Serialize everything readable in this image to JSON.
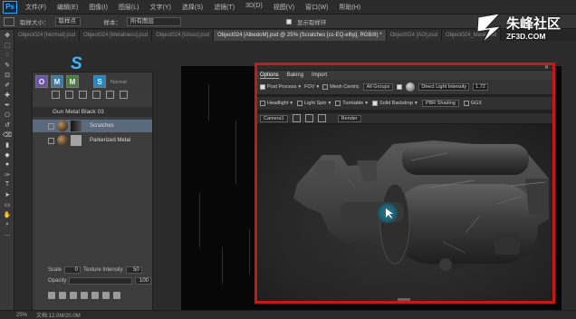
{
  "app": {
    "logo": "Ps"
  },
  "menubar": {
    "items": [
      "文件(F)",
      "编辑(E)",
      "图像(I)",
      "图层(L)",
      "文字(Y)",
      "选择(S)",
      "滤镜(T)",
      "3D(D)",
      "视图(V)",
      "窗口(W)",
      "帮助(H)"
    ]
  },
  "options_bar": {
    "sample_size_label": "取样大小：",
    "sample_size_value": "取样点",
    "sample_label": "样本：",
    "sample_value": "所有图层",
    "show_ring_label": "显示取样环"
  },
  "doc_tabs": [
    {
      "label": "Object024 [Normal].psd",
      "active": false
    },
    {
      "label": "Object024 [Metalness].psd",
      "active": false
    },
    {
      "label": "Object024 [Gloss].psd",
      "active": false
    },
    {
      "label": "Object024 [AlbedoM].psd @ 25% (Scratches [cc-EQ-elhp], RGB/8) *",
      "active": true
    },
    {
      "label": "Object024 [AO].psd",
      "active": false
    },
    {
      "label": "Object024_Mask.psd",
      "active": false
    }
  ],
  "toolbar": {
    "tools": [
      "move-tool",
      "marquee-tool",
      "lasso-tool",
      "quick-select-tool",
      "crop-tool",
      "eyedropper-tool",
      "healing-tool",
      "brush-tool",
      "clone-tool",
      "history-brush-tool",
      "eraser-tool",
      "gradient-tool",
      "blur-tool",
      "dodge-tool",
      "pen-tool",
      "type-tool",
      "path-select-tool",
      "shape-tool",
      "hand-tool",
      "zoom-tool",
      "more-tools"
    ],
    "glyphs": [
      "✥",
      "⬚",
      "◌",
      "✎",
      "⊡",
      "✐",
      "✚",
      "✒",
      "⎔",
      "↺",
      "⌫",
      "▮",
      "◆",
      "●",
      "✑",
      "T",
      "➤",
      "▭",
      "✋",
      "⌕",
      "…"
    ]
  },
  "substance_panel": {
    "buttons": [
      "O",
      "M",
      "M",
      "S"
    ],
    "logo": "S",
    "header_label": "Normal",
    "material_name": "Gun Metal Black 03",
    "layers": [
      {
        "label": "Scratches",
        "selected": true
      },
      {
        "label": "Parkerized Metal",
        "selected": false
      }
    ],
    "params": [
      {
        "label": "Scale",
        "value": "0",
        "label2": "Texture Intensity",
        "value2": "50"
      },
      {
        "label": "Opacity",
        "value": "100"
      }
    ]
  },
  "viewer": {
    "tabs": [
      "Options",
      "Baking",
      "Import"
    ],
    "row1": {
      "post_process": "Post Process",
      "fov": "FOV",
      "mesh_centric": "Mesh Centric",
      "groups": "All Groups",
      "light_mode": "Direct Light Intensity",
      "light_value": "1.72"
    },
    "row2": {
      "headlight": "Headlight",
      "light_spin": "Light Spin",
      "turntable": "Turntable",
      "solid_backdrop": "Solid Backdrop",
      "shading": "PBR Shading",
      "ggx": "GGX"
    },
    "row3": {
      "camera": "Camera1",
      "render": "Render"
    }
  },
  "statusbar": {
    "zoom": "25%",
    "doc_info": "文档:12.0M/20.0M"
  },
  "watermark": {
    "title": "朱峰社区",
    "url": "ZF3D.COM"
  }
}
